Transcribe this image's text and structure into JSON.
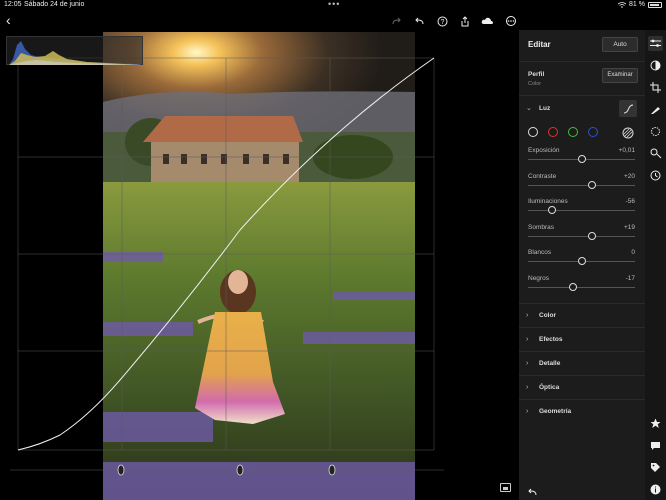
{
  "status": {
    "time": "12:05",
    "date": "Sábado 24 de junio",
    "dots": "•••",
    "battery": "81 %"
  },
  "panel": {
    "title": "Editar",
    "auto_label": "Auto",
    "perfil": {
      "label": "Perfil",
      "value": "Color",
      "button": "Examinar"
    },
    "luz": {
      "title": "Luz",
      "sliders": [
        {
          "name": "Exposición",
          "value": "+0,01",
          "pos": 0.5
        },
        {
          "name": "Contraste",
          "value": "+20",
          "pos": 0.6
        },
        {
          "name": "Iluminaciones",
          "value": "-56",
          "pos": 0.22
        },
        {
          "name": "Sombras",
          "value": "+19",
          "pos": 0.6
        },
        {
          "name": "Blancos",
          "value": "0",
          "pos": 0.5
        },
        {
          "name": "Negros",
          "value": "-17",
          "pos": 0.42
        }
      ]
    },
    "sections": [
      "Color",
      "Efectos",
      "Detalle",
      "Óptica",
      "Geometría"
    ]
  },
  "colors": {
    "panel_bg": "#1c1c1c",
    "accent_red": "#e03030",
    "accent_green": "#3fbf3f",
    "accent_blue": "#3050d0"
  }
}
